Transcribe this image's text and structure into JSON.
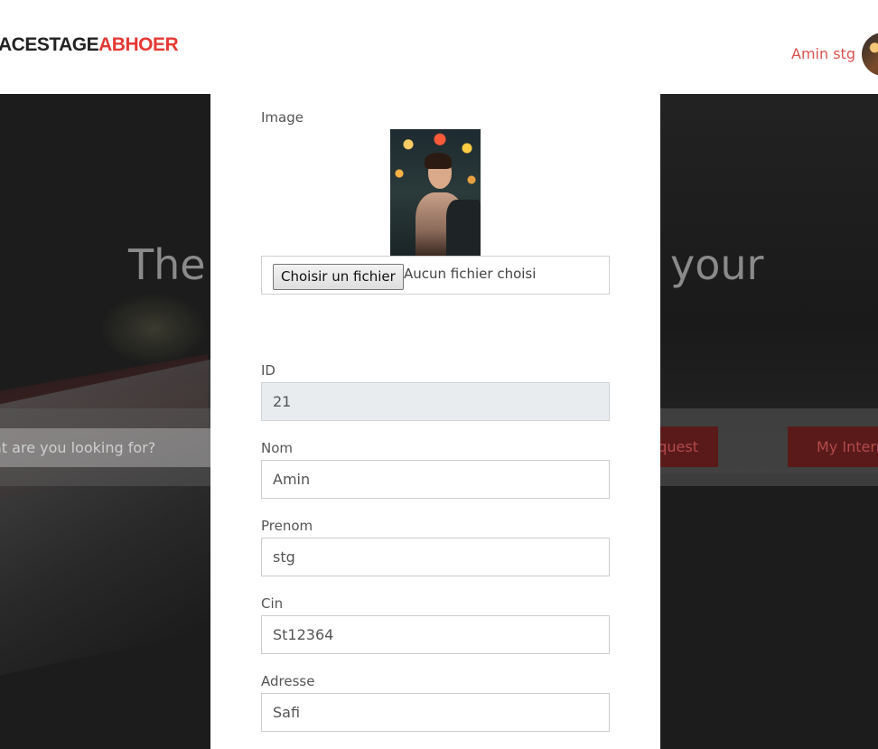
{
  "navbar": {
    "brand_part1": "ACESTAGE",
    "brand_part2": "ABHOER",
    "user_name": "Amin stg"
  },
  "hero": {
    "title_left": "The",
    "title_right": "your",
    "search_placeholder": "at are you looking for?",
    "request_button": "quest",
    "internship_button": "My Intern"
  },
  "form": {
    "image_label": "Image",
    "file_button_label": "Choisir un fichier",
    "file_status": "Aucun fichier choisi",
    "fields": [
      {
        "label": "ID",
        "value": "21",
        "readonly": true
      },
      {
        "label": "Nom",
        "value": "Amin"
      },
      {
        "label": "Prenom",
        "value": "stg"
      },
      {
        "label": "Cin",
        "value": "St12364"
      },
      {
        "label": "Adresse",
        "value": "Safi"
      }
    ]
  },
  "colors": {
    "brand_dark": "#222222",
    "brand_accent": "#e53935",
    "user_name": "#d9534f",
    "readonly_bg": "#e9ecef"
  }
}
